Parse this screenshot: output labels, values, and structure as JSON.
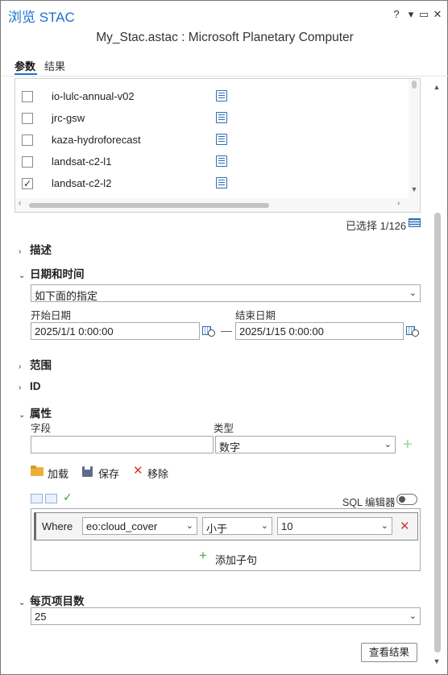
{
  "window": {
    "title": "浏览 STAC",
    "subtitle": "My_Stac.astac : Microsoft Planetary Computer",
    "help_label": "?",
    "menu_label": "▾",
    "pin_label": "▭",
    "close_label": "✕"
  },
  "tabs": [
    {
      "label": "参数",
      "active": true
    },
    {
      "label": "结果",
      "active": false
    }
  ],
  "collections": {
    "items": [
      {
        "label": "io-lulc-annual-v02",
        "checked": false,
        "check": ""
      },
      {
        "label": "jrc-gsw",
        "checked": false,
        "check": ""
      },
      {
        "label": "kaza-hydroforecast",
        "checked": false,
        "check": ""
      },
      {
        "label": "landsat-c2-l1",
        "checked": false,
        "check": ""
      },
      {
        "label": "landsat-c2-l2",
        "checked": true,
        "check": "✓"
      }
    ],
    "selected_count": "已选择 1/126"
  },
  "sections": {
    "description": "描述",
    "datetime": "日期和时间",
    "extent": "范围",
    "id": "ID",
    "properties": "属性",
    "items_per_page": "每页项目数"
  },
  "datetime": {
    "mode_value": "如下面的指定",
    "start_label": "开始日期",
    "start_value": "2025/1/1 0:00:00",
    "end_label": "结束日期",
    "end_value": "2025/1/15 0:00:00",
    "separator": "—"
  },
  "properties": {
    "field_label": "字段",
    "field_value": "",
    "type_label": "类型",
    "type_value": "数字",
    "add_symbol": "+",
    "load_label": "加载",
    "save_label": "保存",
    "remove_label": "移除",
    "sql_editor_label": "SQL 编辑器",
    "sql_editor_on": false,
    "clause": {
      "where_label": "Where",
      "field": "eo:cloud_cover",
      "operator": "小于",
      "value": "10",
      "delete_symbol": "✕"
    },
    "add_clause_label": "添加子句"
  },
  "items_per_page": {
    "value": "25"
  },
  "footer": {
    "view_results_label": "查看结果"
  },
  "colors": {
    "accent": "#1c6fd1",
    "delete": "#d33a2c",
    "add": "#4aa64a",
    "folder": "#e9b13a"
  }
}
